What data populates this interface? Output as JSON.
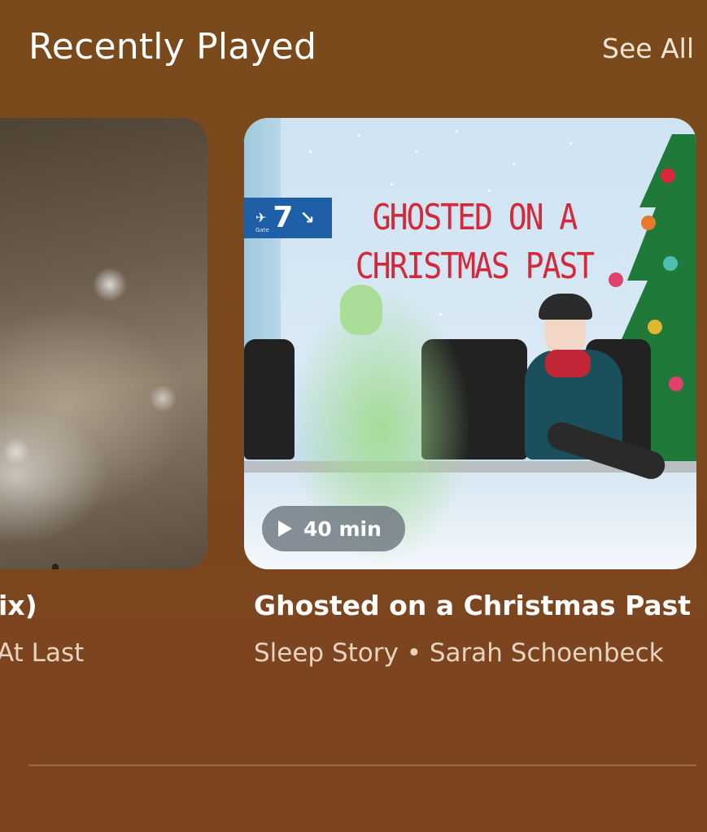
{
  "section": {
    "title": "Recently Played",
    "see_all": "See All"
  },
  "cards": [
    {
      "title": "ix)",
      "subtitle": "At Last"
    },
    {
      "title": "Ghosted on a Christmas Past",
      "subtitle": "Sleep Story • Sarah Schoenbeck",
      "art_title": "GHOSTED ON A CHRISTMAS PAST",
      "gate_number": "7",
      "gate_label": "Gate",
      "duration": "40 min"
    }
  ],
  "colors": {
    "background": "#7a4a1c",
    "accent_red": "#d4283b",
    "gate_blue": "#1f5fa8",
    "pill": "#6e7880"
  }
}
